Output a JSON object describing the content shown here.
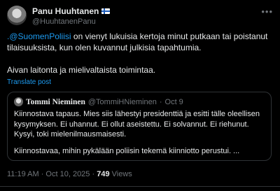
{
  "author": {
    "name": "Panu Huuhtanen",
    "flag": "finnish-flag-icon",
    "handle": "@HuuhtanenPanu"
  },
  "tweet": {
    "mention": ".@SuomenPoliisi",
    "text_1": " on vienyt lukuisia kertoja minut putkaan tai poistanut tilaisuuksista, kun olen kuvannut julkisia tapahtumia.",
    "text_2": "Aivan laitonta ja mielivaltaista toimintaa.",
    "translate_label": "Translate post"
  },
  "quote": {
    "name": "Tommi Nieminen",
    "handle": "@TommiHNieminen",
    "separator": "·",
    "date": "Oct 9",
    "text_1": "Kiinnostava tapaus. Mies siis lähestyi presidenttiä ja esitti tälle oleellisen kysymyksen. Ei uhannut. Ei ollut aseistettu. Ei solvannut. Ei riehunut. Kysyi, toki mielenilmausmaisesti.",
    "text_2": "Kiinnostavaa, mihin pykälään poliisin tekemä kiinniotto perustui. ..."
  },
  "meta": {
    "timestamp": "11:19 AM · Oct 10, 2025 · ",
    "views_count": "749",
    "views_label": " Views"
  },
  "colors": {
    "background": "#000000",
    "text": "#e7e9ea",
    "muted": "#71767b",
    "link": "#1d9bf0",
    "border": "#2f3336"
  }
}
